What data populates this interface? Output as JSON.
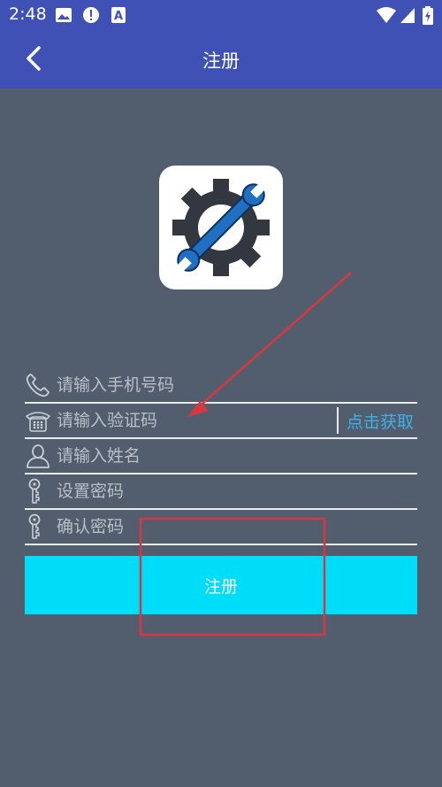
{
  "status_bar": {
    "time": "2:48",
    "icons": [
      "image-icon",
      "alert-icon",
      "font-icon",
      "wifi-icon",
      "signal-icon",
      "battery-icon"
    ]
  },
  "app_bar": {
    "title": "注册",
    "back_icon": "chevron-left-icon"
  },
  "colors": {
    "app_bar": "#3f51b5",
    "background": "#525e6e",
    "button": "#00ddf9",
    "link": "#3fb1ea",
    "annotation": "#d8383d"
  },
  "form": {
    "phone_placeholder": "请输入手机号码",
    "code_placeholder": "请输入验证码",
    "get_code_label": "点击获取",
    "name_placeholder": "请输入姓名",
    "password_placeholder": "设置密码",
    "confirm_placeholder": "确认密码",
    "submit_label": "注册"
  }
}
